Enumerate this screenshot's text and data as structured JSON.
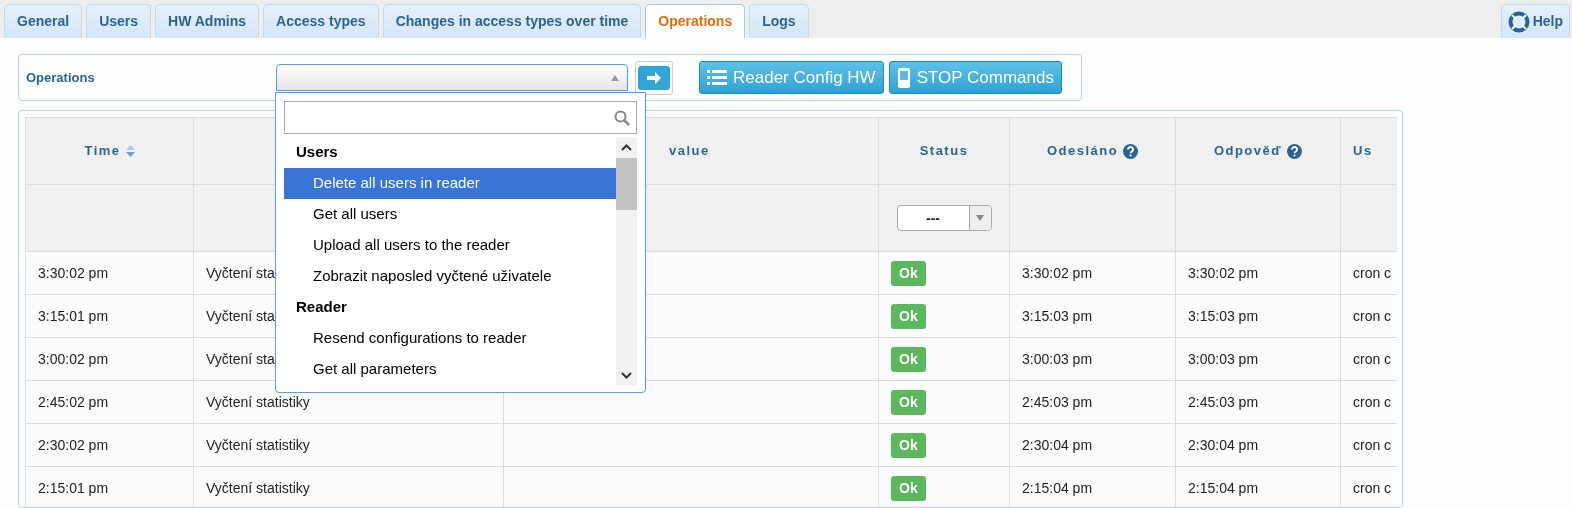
{
  "tabs": [
    {
      "label": "General",
      "selected": false
    },
    {
      "label": "Users",
      "selected": false
    },
    {
      "label": "HW Admins",
      "selected": false
    },
    {
      "label": "Access types",
      "selected": false
    },
    {
      "label": "Changes in access types over time",
      "selected": false
    },
    {
      "label": "Operations",
      "selected": true
    },
    {
      "label": "Logs",
      "selected": false
    }
  ],
  "help_button": {
    "label": "Help"
  },
  "operations_bar": {
    "label": "Operations",
    "select": {
      "expanded": true
    },
    "buttons": [
      {
        "kind": "list",
        "label": "Reader Config HW"
      },
      {
        "kind": "device",
        "label": "STOP Commands"
      }
    ]
  },
  "dropdown": {
    "groups": [
      {
        "label": "Users",
        "options": [
          {
            "label": "Delete all users in reader",
            "selected": true
          },
          {
            "label": "Get all users",
            "selected": false
          },
          {
            "label": "Upload all users to the reader",
            "selected": false
          },
          {
            "label": "Zobrazit naposled vyčtené uživatele",
            "selected": false
          }
        ]
      },
      {
        "label": "Reader",
        "options": [
          {
            "label": "Resend configurations to reader",
            "selected": false
          },
          {
            "label": "Get all parameters",
            "selected": false
          }
        ]
      }
    ]
  },
  "table": {
    "columns": [
      {
        "label": "Time",
        "sortable": true
      },
      {},
      {
        "label": "value"
      },
      {
        "label": "Status"
      },
      {
        "label": "Odesláno",
        "help": true
      },
      {
        "label": "Odpověď",
        "help": true
      },
      {
        "label": "Us"
      }
    ],
    "status_filter": "---",
    "rows": [
      {
        "time": "3:30:02 pm",
        "operation": "Vyčtení sta",
        "status": "Ok",
        "sent": "3:30:02 pm",
        "response": "3:30:02 pm",
        "column_7": "cron c"
      },
      {
        "time": "3:15:01 pm",
        "operation": "Vyčtení sta",
        "status": "Ok",
        "sent": "3:15:03 pm",
        "response": "3:15:03 pm",
        "column_7": "cron c"
      },
      {
        "time": "3:00:02 pm",
        "operation": "Vyčtení sta",
        "status": "Ok",
        "sent": "3:00:03 pm",
        "response": "3:00:03 pm",
        "column_7": "cron c"
      },
      {
        "time": "2:45:02 pm",
        "operation": "Vyčtení statistiky",
        "status": "Ok",
        "sent": "2:45:03 pm",
        "response": "2:45:03 pm",
        "column_7": "cron c"
      },
      {
        "time": "2:30:02 pm",
        "operation": "Vyčtení statistiky",
        "status": "Ok",
        "sent": "2:30:04 pm",
        "response": "2:30:04 pm",
        "column_7": "cron c"
      },
      {
        "time": "2:15:01 pm",
        "operation": "Vyčtení statistiky",
        "status": "Ok",
        "sent": "2:15:04 pm",
        "response": "2:15:04 pm",
        "column_7": "cron c"
      }
    ]
  }
}
